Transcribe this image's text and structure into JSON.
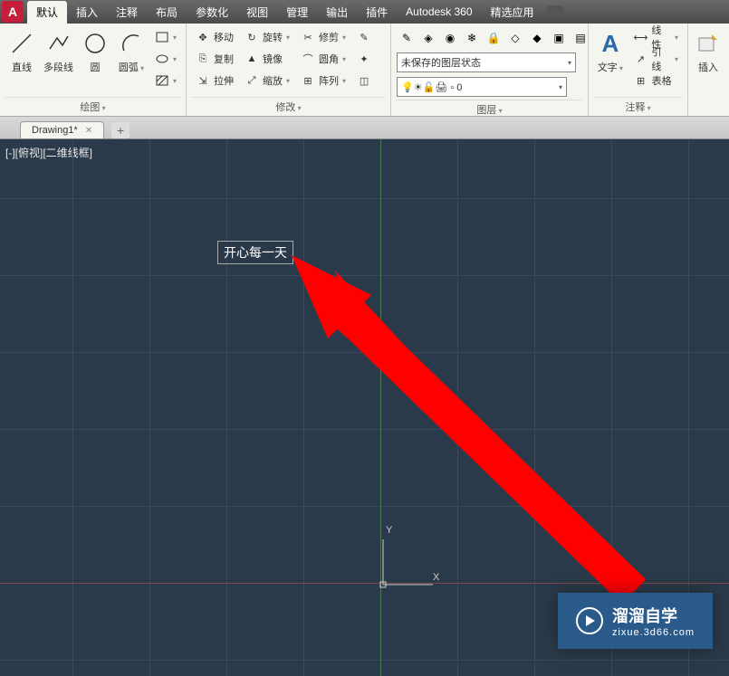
{
  "menubar": {
    "items": [
      "默认",
      "插入",
      "注释",
      "布局",
      "参数化",
      "视图",
      "管理",
      "输出",
      "插件",
      "Autodesk 360",
      "精选应用"
    ]
  },
  "ribbon": {
    "draw": {
      "title": "绘图",
      "line": "直线",
      "polyline": "多段线",
      "circle": "圆",
      "arc": "圆弧"
    },
    "modify": {
      "title": "修改",
      "move": "移动",
      "copy": "复制",
      "stretch": "拉伸",
      "rotate": "旋转",
      "mirror": "镜像",
      "scale": "缩放",
      "trim": "修剪",
      "fillet": "圆角",
      "array": "阵列"
    },
    "layer": {
      "title": "图层",
      "unsaved_state": "未保存的图层状态",
      "layer_zero": "0"
    },
    "annotation": {
      "title": "注释",
      "text": "文字",
      "linear": "线性",
      "leader": "引线",
      "table": "表格"
    },
    "insert": {
      "title": "",
      "insert": "插入"
    }
  },
  "tabs": {
    "file": "Drawing1*"
  },
  "drawing": {
    "view_label": "[-][俯视][二维线框]",
    "text_content": "开心每一天",
    "axis_y": "Y",
    "axis_x": "X"
  },
  "watermark": {
    "main": "溜溜自学",
    "sub": "zixue.3d66.com"
  }
}
